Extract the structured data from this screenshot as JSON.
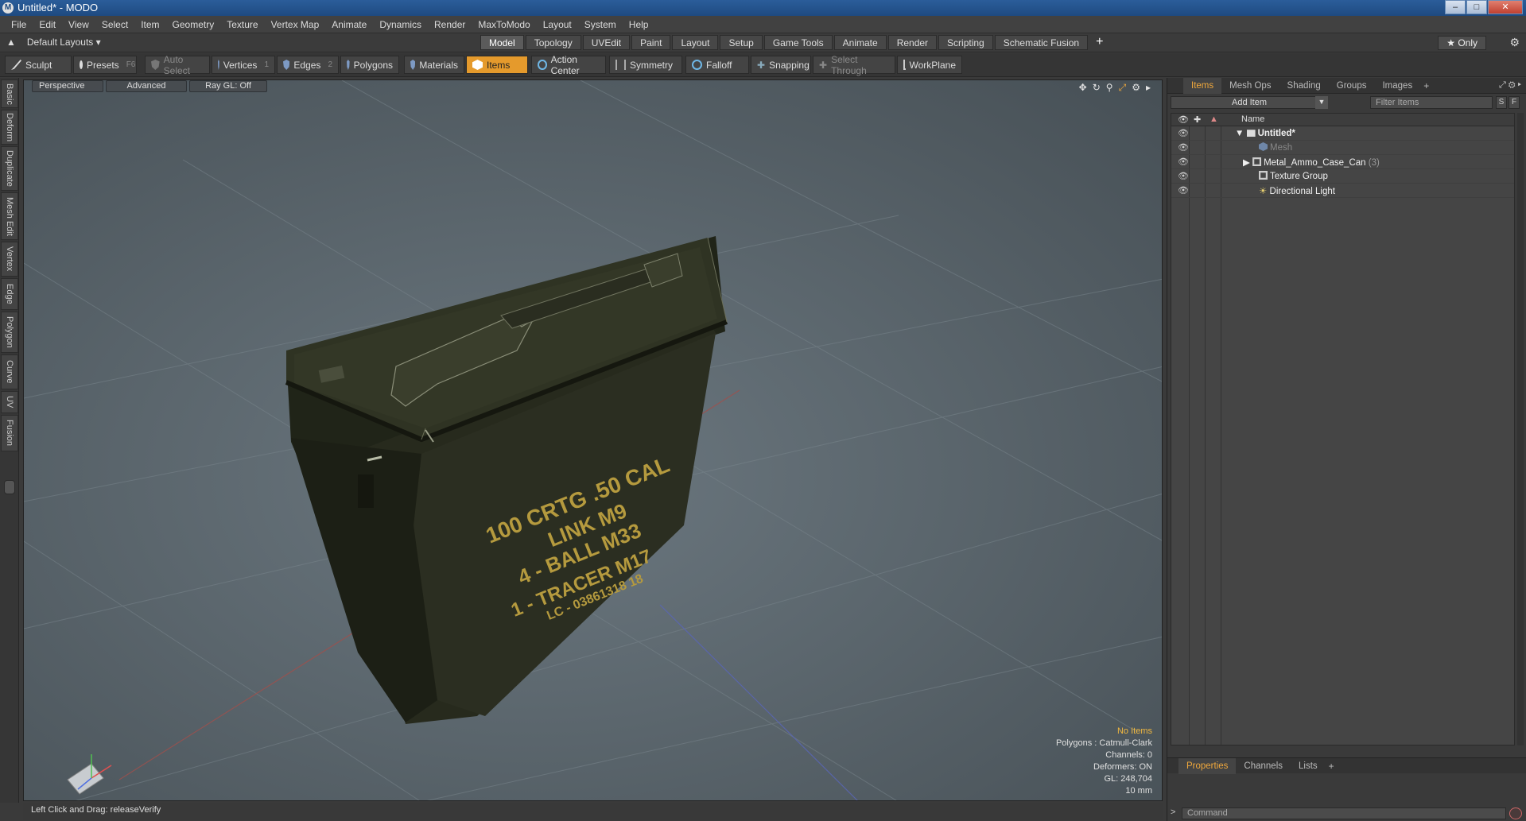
{
  "window": {
    "title": "Untitled* - MODO"
  },
  "menu": [
    "File",
    "Edit",
    "View",
    "Select",
    "Item",
    "Geometry",
    "Texture",
    "Vertex Map",
    "Animate",
    "Dynamics",
    "Render",
    "MaxToModo",
    "Layout",
    "System",
    "Help"
  ],
  "layout_bar": {
    "layout_label": "Default Layouts ▾",
    "tabs": [
      "Model",
      "Topology",
      "UVEdit",
      "Paint",
      "Layout",
      "Setup",
      "Game Tools",
      "Animate",
      "Render",
      "Scripting",
      "Schematic Fusion"
    ],
    "active_tab": "Model",
    "only_label": "★ Only"
  },
  "toolbar": {
    "sculpt": "Sculpt",
    "presets": "Presets",
    "presets_key": "F6",
    "auto_select": "Auto Select",
    "vertices": "Vertices",
    "vertices_key": "1",
    "edges": "Edges",
    "edges_key": "2",
    "polygons": "Polygons",
    "materials": "Materials",
    "items": "Items",
    "action_center": "Action Center",
    "symmetry": "Symmetry",
    "falloff": "Falloff",
    "snapping": "Snapping",
    "select_through": "Select Through",
    "workplane": "WorkPlane"
  },
  "left_tabs": [
    "Basic",
    "Deform",
    "Duplicate",
    "Mesh Edit",
    "Vertex",
    "Edge",
    "Polygon",
    "Curve",
    "UV",
    "Fusion"
  ],
  "viewport": {
    "view_mode": "Perspective",
    "advanced": "Advanced",
    "raygl": "Ray GL: Off",
    "box_text": [
      "100 CRTG .50 CAL",
      "LINK M9",
      "4 - BALL M33",
      "1 - TRACER M17",
      "LC - 03861318 18"
    ],
    "info": {
      "no_items": "No Items",
      "polygons": "Polygons : Catmull-Clark",
      "channels": "Channels: 0",
      "deformers": "Deformers: ON",
      "gl": "GL: 248,704",
      "scale": "10 mm"
    }
  },
  "status": {
    "text": "Left Click and Drag:   releaseVerify"
  },
  "right_panel": {
    "tabs": [
      "Items",
      "Mesh Ops",
      "Shading",
      "Groups",
      "Images"
    ],
    "active_tab": "Items",
    "add_item": "Add Item",
    "filter_placeholder": "Filter Items",
    "s_btn": "S",
    "f_btn": "F",
    "col_name": "Name",
    "tree": [
      {
        "label": "Untitled*",
        "bold": true
      },
      {
        "label": "Mesh",
        "dim": true
      },
      {
        "label": "Metal_Ammo_Case_Can",
        "count": "(3)"
      },
      {
        "label": "Texture Group"
      },
      {
        "label": "Directional Light"
      }
    ],
    "props_tabs": [
      "Properties",
      "Channels",
      "Lists"
    ],
    "props_active": "Properties",
    "command_placeholder": "Command"
  },
  "colors": {
    "accent": "#e59a2c",
    "box_text": "#b59a3e",
    "titlebar": "#2b5d9a"
  }
}
